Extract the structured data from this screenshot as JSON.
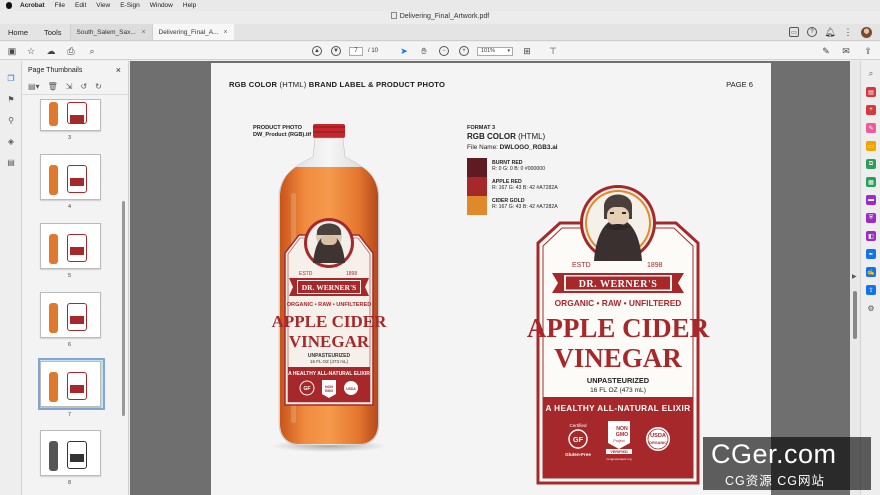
{
  "menubar": {
    "app": "Acrobat",
    "items": [
      "File",
      "Edit",
      "View",
      "E-Sign",
      "Window",
      "Help"
    ]
  },
  "window_title": "Delivering_Final_Artwork.pdf",
  "tabbar": {
    "home": "Home",
    "tools": "Tools",
    "tabs": [
      {
        "label": "South_Salem_Sax...",
        "active": false
      },
      {
        "label": "Delivering_Final_A...",
        "active": true
      }
    ],
    "close_glyph": "×"
  },
  "toolbar": {
    "page_current": "7",
    "page_total": "/ 10",
    "zoom": "101%"
  },
  "thumbnails": {
    "title": "Page Thumbnails",
    "close_glyph": "×",
    "page_numbers": [
      "3",
      "4",
      "5",
      "6",
      "7",
      "8"
    ],
    "selected_page": "7"
  },
  "page": {
    "header_bold": "RGB COLOR",
    "header_thin": " (HTML) ",
    "header_bold2": "BRAND LABEL & PRODUCT PHOTO",
    "page_label": "PAGE 6",
    "product_photo_label": "PRODUCT PHOTO",
    "product_photo_file": "DW_Product (RGB).tif",
    "format_label": "FORMAT 3",
    "format_title_bold": "RGB COLOR",
    "format_title_thin": " (HTML)",
    "file_name_label": "File Name: ",
    "file_name": "DWLOGO_RGB3.ai",
    "swatches": [
      {
        "name": "BURNT RED",
        "values": "R: 0 G: 0 B: 0  #000000",
        "color": "#5e1b22"
      },
      {
        "name": "APPLE RED",
        "values": "R: 167 G: 43 B: 42  #A7282A",
        "color": "#a7282a"
      },
      {
        "name": "CIDER GOLD",
        "values": "R: 167 G: 43 B: 42  #A7282A",
        "color": "#e0892b"
      }
    ]
  },
  "label": {
    "estd": "ESTD",
    "year": "1898",
    "brand": "DR. WERNER'S",
    "tagline": "ORGANIC • RAW • UNFILTERED",
    "line1": "APPLE CIDER",
    "line2": "VINEGAR",
    "unpasteurized": "UNPASTEURIZED",
    "volume": "16 FL OZ (473 mL)",
    "elixir": "A HEALTHY ALL-NATURAL ELIXIR",
    "badge_gf_top": "Certified",
    "badge_gf": "GF",
    "badge_gf_bottom": "Gluten-Free",
    "badge_nongmo_1": "NON",
    "badge_nongmo_2": "GMO",
    "badge_nongmo_3": "Project",
    "badge_nongmo_4": "VERIFIED",
    "badge_nongmo_5": "nongmoproject.org",
    "badge_usda_1": "USDA",
    "badge_usda_2": "ORGANIC"
  },
  "watermark": {
    "main": "CGer.com",
    "sub": "CG资源 CG网站"
  },
  "colors": {
    "apple_red": "#a7282a",
    "cider_gold": "#e0892b",
    "burnt_red": "#5e1b22",
    "accent": "#1473e6"
  }
}
